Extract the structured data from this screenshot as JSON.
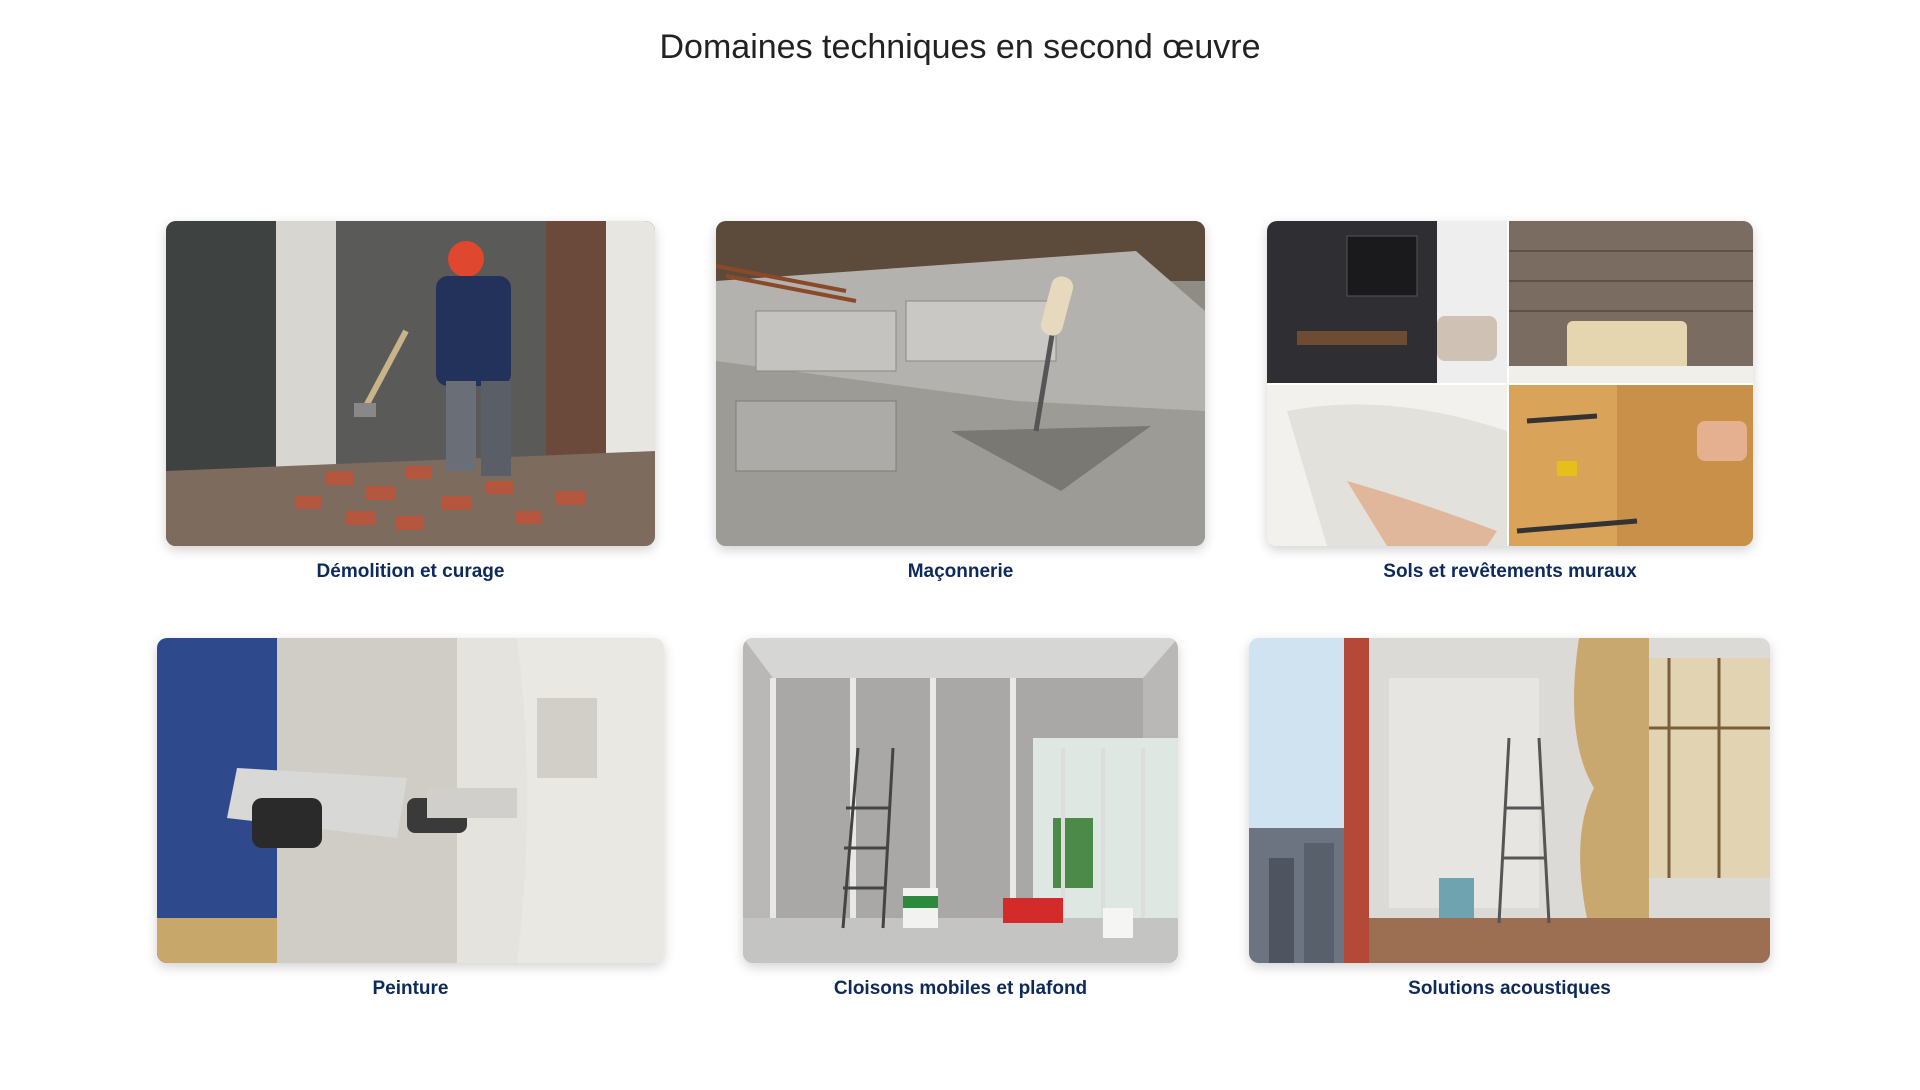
{
  "page": {
    "title": "Domaines techniques en second œuvre"
  },
  "colors": {
    "caption": "#0e2a5c",
    "title": "#222222"
  },
  "cards": [
    {
      "caption": "Démolition et curage",
      "image_icon": "demolition-photo"
    },
    {
      "caption": "Maçonnerie",
      "image_icon": "masonry-photo"
    },
    {
      "caption": "Sols et revêtements muraux",
      "image_icon": "floor-wall-coverings-photo"
    },
    {
      "caption": "Peinture",
      "image_icon": "painting-photo"
    },
    {
      "caption": "Cloisons mobiles et plafond",
      "image_icon": "partitions-ceiling-photo"
    },
    {
      "caption": "Solutions acoustiques",
      "image_icon": "acoustic-solutions-photo"
    }
  ]
}
